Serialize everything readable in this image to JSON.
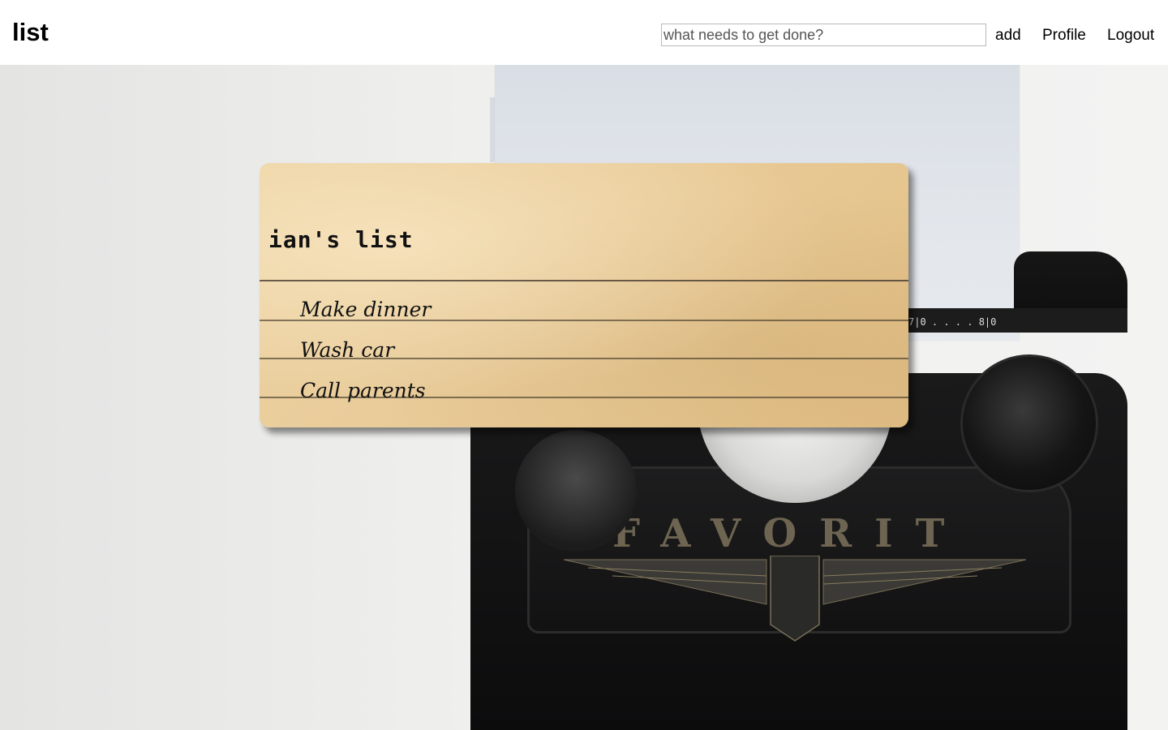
{
  "navbar": {
    "brand": "list",
    "task_input_placeholder": "what needs to get done?",
    "add_label": "add",
    "profile_label": "Profile",
    "logout_label": "Logout"
  },
  "background": {
    "typewriter_brand": "FAVORIT",
    "ruler_text": "7|0 . . . . 8|0"
  },
  "card": {
    "title": "ian's list",
    "items": [
      {
        "label": "Make dinner"
      },
      {
        "label": "Wash car"
      },
      {
        "label": "Call parents"
      }
    ]
  }
}
